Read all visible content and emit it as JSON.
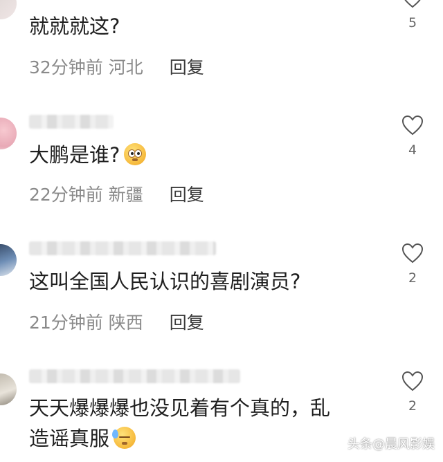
{
  "comments": [
    {
      "text": "就就就这?",
      "time": "32分钟前",
      "location": "河北",
      "reply_label": "回复",
      "likes": "5"
    },
    {
      "text": "大鹏是谁?",
      "time": "22分钟前",
      "location": "新疆",
      "reply_label": "回复",
      "likes": "4",
      "emoji": "flushed-face"
    },
    {
      "text": "这叫全国人民认识的喜剧演员?",
      "time": "21分钟前",
      "location": "陕西",
      "reply_label": "回复",
      "likes": "2"
    },
    {
      "text_line1": "天天爆爆爆也没见着有个真的，乱",
      "text_line2": "造谣真服",
      "likes": "2",
      "emoji": "sweat-face"
    }
  ],
  "watermark": "头条@晨风影娱",
  "icons": {
    "like": "heart-outline-icon"
  },
  "colors": {
    "meta_text": "#8a8a8a",
    "reply_text": "#3a3a3a",
    "heart_stroke": "#555555"
  }
}
